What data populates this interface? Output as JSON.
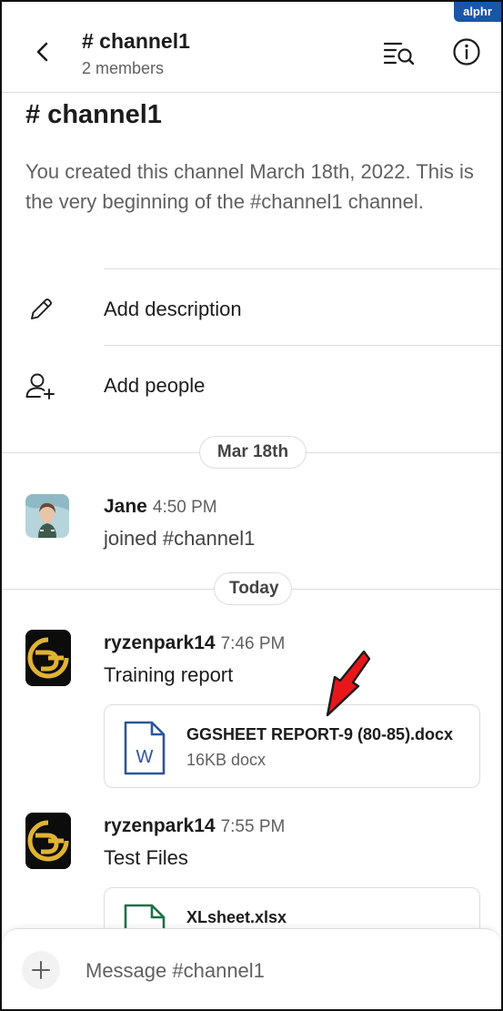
{
  "watermark": "alphr",
  "header": {
    "title": "# channel1",
    "members": "2 members"
  },
  "intro": {
    "heading": "# channel1",
    "text": "You created this channel March 18th, 2022. This is the very beginning of the #channel1 channel."
  },
  "actions": [
    {
      "label": "Add description",
      "icon": "pencil-icon"
    },
    {
      "label": "Add people",
      "icon": "add-person-icon"
    }
  ],
  "date_dividers": [
    "Mar 18th",
    "Today"
  ],
  "messages": [
    {
      "author": "Jane",
      "time": "4:50 PM",
      "text": "joined #channel1",
      "avatar": "photo"
    },
    {
      "author": "ryzenpark14",
      "time": "7:46 PM",
      "text": "Training report",
      "avatar": "gold-logo",
      "file": {
        "name": "GGSHEET REPORT-9 (80-85).docx",
        "meta": "16KB docx",
        "icon": "word-doc-icon"
      }
    },
    {
      "author": "ryzenpark14",
      "time": "7:55 PM",
      "text": "Test Files",
      "avatar": "gold-logo",
      "file": {
        "name": "XLsheet.xlsx",
        "meta": "",
        "icon": "excel-doc-icon"
      }
    }
  ],
  "composer": {
    "placeholder": "Message #channel1"
  },
  "colors": {
    "annotation_arrow": "#e8161b",
    "word_blue": "#2b579a",
    "excel_green": "#1d7044",
    "logo_gold": "#e0b332"
  }
}
